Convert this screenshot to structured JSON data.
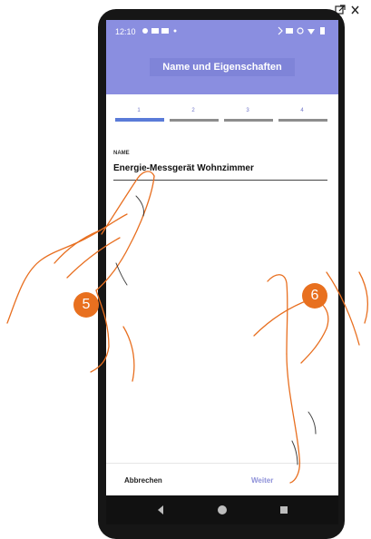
{
  "status_bar": {
    "time": "12:10"
  },
  "header": {
    "title": "Name und Eigenschaften"
  },
  "stepper": {
    "steps": [
      "1",
      "2",
      "3",
      "4"
    ],
    "active_step": 1
  },
  "form": {
    "field_label": "NAME",
    "field_value": "Energie-Messgerät Wohnzimmer"
  },
  "actions": {
    "cancel_label": "Abbrechen",
    "next_label": "Weiter"
  },
  "annotations": {
    "step_a": "5",
    "step_b": "6"
  },
  "colors": {
    "accent": "#8a8ee0",
    "badge": "#e8701f",
    "active_step": "#5a7bd8"
  },
  "icons": {
    "corner": [
      "external-link-icon",
      "close-icon"
    ],
    "status_left": [
      "fan-icon",
      "media-icon",
      "media-icon",
      "dot-icon"
    ],
    "status_right": [
      "bluetooth-icon",
      "signal-icon",
      "data-icon",
      "wifi-icon",
      "battery-icon"
    ],
    "nav": [
      "back-icon",
      "home-icon",
      "recents-icon"
    ]
  }
}
